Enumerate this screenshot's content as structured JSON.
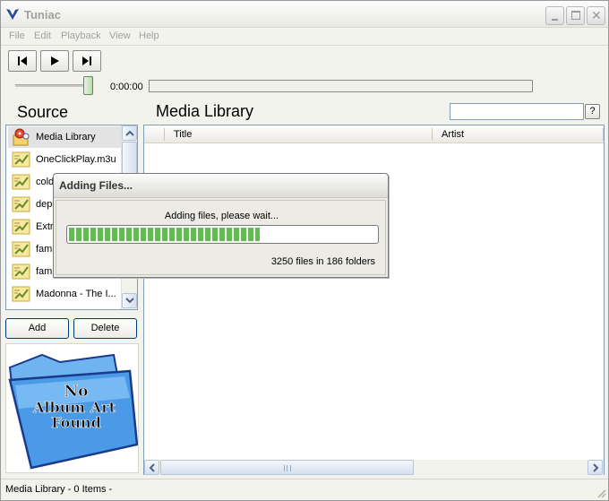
{
  "window": {
    "title": "Tuniac"
  },
  "menu": [
    "File",
    "Edit",
    "Playback",
    "View",
    "Help"
  ],
  "transport": {
    "time": "0:00:00",
    "volume_fraction": 0.93
  },
  "source": {
    "title": "Source",
    "items": [
      {
        "label": "Media Library",
        "icon": "media-library-icon",
        "selected": true
      },
      {
        "label": "OneClickPlay.m3u",
        "icon": "playlist-icon"
      },
      {
        "label": "coldp",
        "icon": "playlist-icon"
      },
      {
        "label": "depe",
        "icon": "playlist-icon"
      },
      {
        "label": "Extr",
        "icon": "playlist-icon"
      },
      {
        "label": "fama",
        "icon": "playlist-icon"
      },
      {
        "label": "fama",
        "icon": "playlist-icon"
      },
      {
        "label": "Madonna - The I...",
        "icon": "playlist-icon"
      }
    ],
    "add_label": "Add",
    "delete_label": "Delete",
    "album_art_text": [
      "No",
      "Album Art",
      "Found"
    ]
  },
  "main": {
    "title": "Media Library",
    "search_value": "",
    "help_label": "?",
    "columns": [
      "Title",
      "Artist"
    ]
  },
  "dialog": {
    "title": "Adding Files...",
    "message": "Adding files, please wait...",
    "progress_fraction": 0.62,
    "count_text": "3250 files in 186 folders"
  },
  "status": {
    "text": "Media Library - 0 Items -"
  },
  "colors": {
    "progress": "#5fbf4c",
    "selection_border": "#7f9db9"
  }
}
